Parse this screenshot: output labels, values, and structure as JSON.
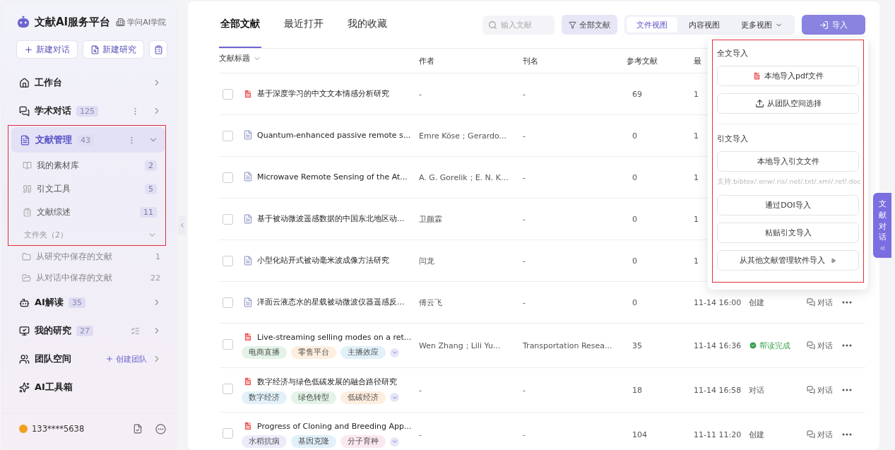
{
  "sidebar": {
    "brand": {
      "title": "文献AI服务平台",
      "link": "学问AI学院"
    },
    "actions": [
      {
        "label": "新建对话"
      },
      {
        "label": "新建研究"
      }
    ],
    "nav": [
      {
        "label": "工作台",
        "selected": false,
        "expanded": false
      },
      {
        "label": "学术对话",
        "count": "125",
        "has_menu": true,
        "selected": false,
        "expanded": false
      },
      {
        "label": "文献管理",
        "count": "43",
        "has_menu": true,
        "selected": true,
        "expanded": true,
        "highlighted": true,
        "children": [
          {
            "label": "我的素材库",
            "count": "2"
          },
          {
            "label": "引文工具",
            "count": "5"
          },
          {
            "label": "文献综述",
            "count": "11"
          }
        ],
        "folder": {
          "label": "文件夹（2）",
          "expanded": true,
          "children": [
            {
              "label": "从研究中保存的文献",
              "count": "1"
            },
            {
              "label": "从对话中保存的文献",
              "count": "22"
            }
          ]
        }
      },
      {
        "label": "AI解读",
        "count": "35",
        "selected": false,
        "expanded": false
      },
      {
        "label": "我的研究",
        "count": "27",
        "has_list": true,
        "selected": false,
        "expanded": false
      },
      {
        "label": "团队空间",
        "action": "创建团队",
        "selected": false,
        "expanded": false
      },
      {
        "label": "AI工具箱",
        "selected": false
      }
    ],
    "user": {
      "phone": "133****5638"
    }
  },
  "tabs": [
    {
      "label": "全部文献",
      "selected": true
    },
    {
      "label": "最近打开",
      "selected": false
    },
    {
      "label": "我的收藏",
      "selected": false
    }
  ],
  "search": {
    "placeholder": "输入文献"
  },
  "filter": {
    "label": "全部文献"
  },
  "views": [
    {
      "label": "文件视图",
      "selected": true
    },
    {
      "label": "内容视图",
      "selected": false
    },
    {
      "label": "更多视图",
      "selected": false,
      "kind": "menu"
    }
  ],
  "import_button": {
    "label": "导入"
  },
  "table": {
    "columns": [
      "文献标题",
      "作者",
      "刊名",
      "参考文献",
      "最"
    ],
    "rows": [
      {
        "checked": false,
        "kind": "pdf",
        "title": "基于深度学习的中文文本情感分析研究",
        "author": "-",
        "journal": "-",
        "refs": "69",
        "date": "1"
      },
      {
        "checked": false,
        "kind": "doc",
        "title": "Quantum-enhanced passive remote s...",
        "author": "Emre Köse；Gerardo...",
        "journal": "-",
        "refs": "0",
        "date": "1"
      },
      {
        "checked": false,
        "kind": "doc",
        "title": "Microwave Remote Sensing of the At...",
        "author": "A. G. Gorelik；E. N. K...",
        "journal": "-",
        "refs": "0",
        "date": "1"
      },
      {
        "checked": false,
        "kind": "doc",
        "title": "基于被动微波遥感数据的中国东北地区动...",
        "author": "卫颜霖",
        "journal": "-",
        "refs": "0",
        "date": "1"
      },
      {
        "checked": false,
        "kind": "doc",
        "title": "小型化站开式被动毫米波成像方法研究",
        "author": "闫龙",
        "journal": "-",
        "refs": "0",
        "date": "1"
      },
      {
        "checked": false,
        "kind": "doc",
        "title": "洋面云液态水的星载被动微波仪器遥感反...",
        "author": "傅云飞",
        "journal": "-",
        "refs": "0",
        "date": "11-14 16:00",
        "status": "创建",
        "done": false,
        "chat": "对话"
      },
      {
        "checked": false,
        "kind": "pdf",
        "title": "Live-streaming selling modes on a ret...",
        "author": "Wen Zhang；Lili Yu...",
        "journal": "Transportation Resea...",
        "refs": "35",
        "date": "11-14 16:36",
        "status": "帮读完成",
        "done": true,
        "chat": "对话",
        "tags": [
          {
            "label": "电商直播",
            "color": "#e4f3e7"
          },
          {
            "label": "零售平台",
            "color": "#fdeee0"
          },
          {
            "label": "主播效应",
            "color": "#e2f1f9"
          }
        ]
      },
      {
        "checked": false,
        "kind": "pdf",
        "title": "数字经济与绿色低碳发展的融合路径研究",
        "author": "-",
        "journal": "-",
        "refs": "18",
        "date": "11-14 16:58",
        "status": "对话",
        "done": false,
        "chat": "对话",
        "tags": [
          {
            "label": "数字经济",
            "color": "#e2f1f9"
          },
          {
            "label": "绿色转型",
            "color": "#e4f3e7"
          },
          {
            "label": "低碳经济",
            "color": "#fdeee0"
          }
        ]
      },
      {
        "checked": false,
        "kind": "pdf",
        "title": "Progress of Cloning and Breeding App...",
        "author": "-",
        "journal": "-",
        "refs": "104",
        "date": "11-11 11:20",
        "status": "创建",
        "done": false,
        "chat": "对话",
        "tags": [
          {
            "label": "水稻抗病",
            "color": "#ecebfa"
          },
          {
            "label": "基因克隆",
            "color": "#e2f1f9"
          },
          {
            "label": "分子育种",
            "color": "#fbe8f0"
          }
        ]
      }
    ]
  },
  "import_menu": {
    "highlighted": true,
    "sections": [
      {
        "title": "全文导入",
        "items": [
          {
            "kind": "pdf",
            "label": "本地导入pdf文件"
          },
          {
            "kind": "upload",
            "label": "从团队空间选择"
          }
        ]
      },
      {
        "title": "引文导入",
        "items": [
          {
            "kind": "plain",
            "label": "本地导入引文文件"
          },
          {
            "kind": "hint",
            "label": "支持.bibtex/.enw/.ris/.net/.txt/.xml/.ref/.doc"
          },
          {
            "kind": "plain",
            "label": "通过DOI导入"
          },
          {
            "kind": "plain",
            "label": "粘贴引文导入"
          },
          {
            "kind": "submenu",
            "label": "从其他文献管理软件导入"
          }
        ]
      }
    ]
  },
  "side_tab": {
    "label": "文献对话"
  }
}
